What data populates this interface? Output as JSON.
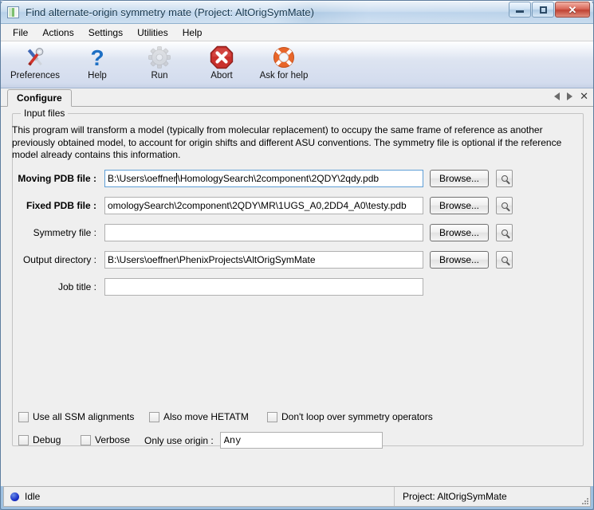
{
  "window": {
    "title": "Find alternate-origin symmetry mate (Project: AltOrigSymMate)",
    "icon": "app-icon",
    "caption": {
      "minimize": "minimize-button",
      "maximize": "maximize-button",
      "close_glyph": "✕"
    }
  },
  "menubar": {
    "items": [
      {
        "label": "File"
      },
      {
        "label": "Actions"
      },
      {
        "label": "Settings"
      },
      {
        "label": "Utilities"
      },
      {
        "label": "Help"
      }
    ]
  },
  "toolbar": {
    "buttons": [
      {
        "label": "Preferences",
        "icon": "tools-icon",
        "enabled": true
      },
      {
        "label": "Help",
        "icon": "question-mark-icon",
        "enabled": true
      },
      {
        "label": "Run",
        "icon": "gear-icon",
        "enabled": false
      },
      {
        "label": "Abort",
        "icon": "stop-sign-icon",
        "enabled": true
      },
      {
        "label": "Ask for help",
        "icon": "life-ring-icon",
        "enabled": true
      }
    ]
  },
  "tabs": {
    "items": [
      {
        "label": "Configure",
        "active": true
      }
    ],
    "controls": {
      "prev": "scroll-tabs-left",
      "next": "scroll-tabs-right",
      "close": "✕"
    }
  },
  "main": {
    "group_legend": "Input files",
    "description": "This program will transform a model (typically from molecular replacement) to occupy the same frame of reference as another previously obtained model, to account for origin shifts and different ASU conventions.  The symmetry file is optional if the reference model already contains this information.",
    "fields": [
      {
        "label": "Moving PDB file :",
        "bold": true,
        "value_before_caret": "B:\\Users\\oeffner",
        "value_after_caret": "\\HomologySearch\\2component\\2QDY\\2qdy.pdb",
        "focused": true,
        "browse_label": "Browse...",
        "has_browse": true,
        "has_magnifier": true
      },
      {
        "label": "Fixed PDB file :",
        "bold": true,
        "value": "omologySearch\\2component\\2QDY\\MR\\1UGS_A0,2DD4_A0\\testy.pdb",
        "focused": false,
        "browse_label": "Browse...",
        "has_browse": true,
        "has_magnifier": true
      },
      {
        "label": "Symmetry file :",
        "bold": false,
        "value": "",
        "focused": false,
        "browse_label": "Browse...",
        "has_browse": true,
        "has_magnifier": true
      },
      {
        "label": "Output directory :",
        "bold": false,
        "value": "B:\\Users\\oeffner\\PhenixProjects\\AltOrigSymMate",
        "focused": false,
        "browse_label": "Browse...",
        "has_browse": true,
        "has_magnifier": true
      },
      {
        "label": "Job title :",
        "bold": false,
        "value": "",
        "focused": false,
        "browse_label": "",
        "has_browse": false,
        "has_magnifier": false
      }
    ],
    "checkboxes_row1": [
      {
        "label": "Use all SSM alignments",
        "checked": false
      },
      {
        "label": "Also move HETATM",
        "checked": false
      },
      {
        "label": "Don't loop over symmetry operators",
        "checked": false
      }
    ],
    "checkboxes_row2": [
      {
        "label": "Debug",
        "checked": false
      },
      {
        "label": "Verbose",
        "checked": false
      }
    ],
    "origin": {
      "label": "Only use origin :",
      "value": "Any"
    }
  },
  "statusbar": {
    "status_text": "Idle",
    "status_color": "#1c32c8",
    "project_text": "Project: AltOrigSymMate"
  }
}
